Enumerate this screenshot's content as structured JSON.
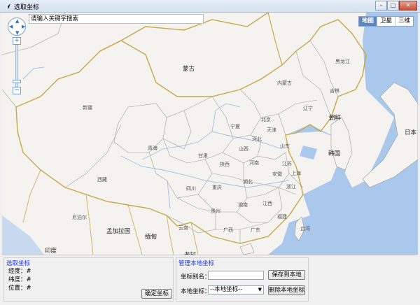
{
  "window": {
    "title": "选取坐标",
    "min": "–",
    "max": "□",
    "close": "✕"
  },
  "map": {
    "search_placeholder": "请输入关键字搜索",
    "zoom_in": "+",
    "zoom_out": "−",
    "types": [
      "地图",
      "卫星",
      "三维"
    ],
    "labels": {
      "mongolia": "蒙古",
      "xinjiang": "新疆",
      "xizang": "西藏",
      "qinghai": "青海",
      "gansu": "甘肃",
      "neimenggu": "内蒙古",
      "heilongjiang": "黑龙江",
      "jilin": "吉林",
      "liaoning": "辽宁",
      "hebei": "河北",
      "beijing": "北京",
      "tianjin": "天津",
      "shanxi": "山西",
      "shandong": "山东",
      "henan": "河南",
      "shaanxi": "陕西",
      "ningxia": "宁夏",
      "sichuan": "四川",
      "chongqing": "重庆",
      "hubei": "湖北",
      "anhui": "安徽",
      "jiangsu": "江苏",
      "shanghai": "上海",
      "zhejiang": "浙江",
      "jiangxi": "江西",
      "hunan": "湖南",
      "guizhou": "贵州",
      "yunnan": "云南",
      "guangxi": "广西",
      "guangdong": "广东",
      "fujian": "福建",
      "taiwan": "台湾",
      "chaoxian": "朝鲜",
      "hanguo": "韩国",
      "riben": "日本",
      "nepal": "尼泊尔",
      "bangladesh": "孟加拉国",
      "myanmar": "缅甸",
      "india": "印度",
      "laos": "老挝"
    }
  },
  "pick": {
    "legend": "选取坐标",
    "lng_label": "经度：",
    "lng_value": "#",
    "lat_label": "纬度：",
    "lat_value": "#",
    "pos_label": "位置：",
    "pos_value": "#",
    "confirm": "确定坐标"
  },
  "manage": {
    "legend": "管理本地坐标",
    "alias_label": "坐标别名：",
    "alias_value": "",
    "save": "保存到本地",
    "local_label": "本地坐标：",
    "local_selected": "--本地坐标--",
    "delete": "删除本地坐标"
  },
  "colors": {
    "sea": "#a9c8ec",
    "land": "#f4f3ef",
    "border_country": "#c9a64c",
    "border_prov": "#9a9a9a",
    "river": "#9cc0e8",
    "accent": "#1c37d8"
  }
}
